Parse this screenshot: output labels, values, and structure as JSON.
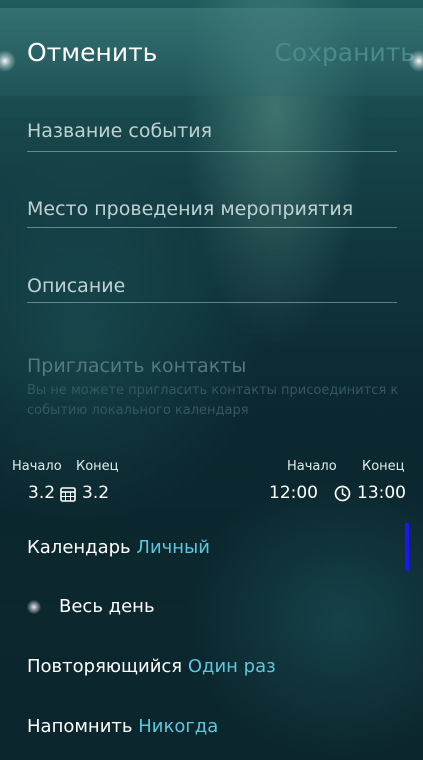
{
  "header": {
    "cancel_label": "Отменить",
    "save_label": "Сохранить"
  },
  "fields": {
    "event_name_placeholder": "Название события",
    "location_placeholder": "Место проведения мероприятия",
    "description_placeholder": "Описание"
  },
  "invite": {
    "title": "Пригласить контакты",
    "description": "Вы не можете пригласить контакты присоединится к событию локального календаря"
  },
  "date": {
    "start_label": "Начало",
    "end_label": "Конец",
    "start_value": "3.2",
    "end_value": "3.2"
  },
  "time": {
    "start_label": "Начало",
    "end_label": "Конец",
    "start_value": "12:00",
    "end_value": "13:00"
  },
  "calendar": {
    "label": "Календарь",
    "value": "Личный"
  },
  "all_day": {
    "label": "Весь день",
    "checked": false
  },
  "recurrence": {
    "label": "Повторяющийся",
    "value": "Один раз"
  },
  "reminder": {
    "label": "Напомнить",
    "value": "Никогда"
  },
  "colors": {
    "accent": "#5ec7de",
    "scrollbar": "#1a14ff",
    "save_disabled": "#4a8a8c"
  },
  "icons": {
    "date": "calendar-icon",
    "time": "clock-icon"
  }
}
